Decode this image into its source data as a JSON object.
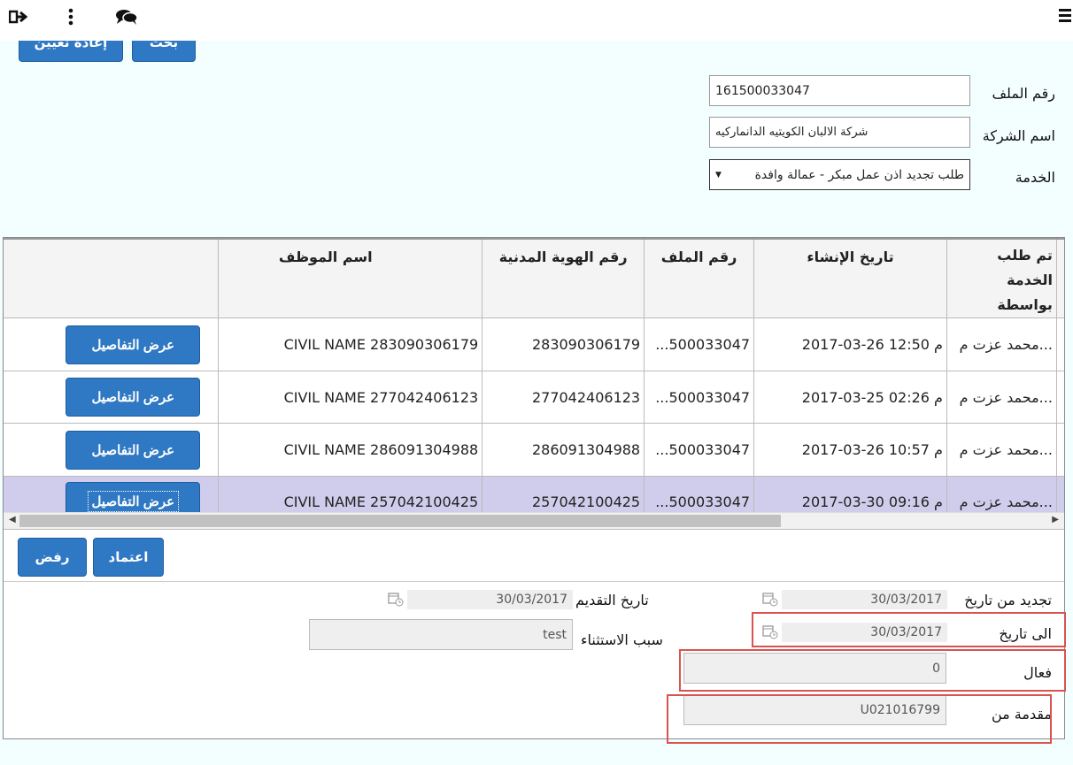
{
  "top_actions": {
    "top_buttons": {
      "search": "بحث",
      "reset": "إعادة تعيين"
    }
  },
  "form": {
    "file_no_label": "رقم الملف",
    "file_no_value": "161500033047",
    "company_label": "اسم الشركة",
    "company_value": "شركة الالبان الكويتيه الدانماركيه",
    "service_label": "الخدمة",
    "service_value": "طلب تجديد اذن عمل مبكر - عمالة وافدة"
  },
  "table": {
    "headers": [
      "تم طلب الخدمة بواسطة",
      "تاريخ الإنشاء",
      "رقم الملف",
      "رقم الهوية المدنية",
      "اسم الموظف",
      ""
    ],
    "detail_label": "عرض التفاصيل",
    "rows": [
      {
        "requested_by": "محمد عزت م...",
        "created": "2017-03-26 م 12:50",
        "file": "...500033047",
        "civil_id": "283090306179",
        "name": "CIVIL NAME 283090306179"
      },
      {
        "requested_by": "محمد عزت م...",
        "created": "2017-03-25 م 02:26",
        "file": "...500033047",
        "civil_id": "277042406123",
        "name": "CIVIL NAME 277042406123"
      },
      {
        "requested_by": "محمد عزت م...",
        "created": "2017-03-26 م 10:57",
        "file": "...500033047",
        "civil_id": "286091304988",
        "name": "CIVIL NAME 286091304988"
      },
      {
        "requested_by": "محمد عزت م...",
        "created": "2017-03-30 م 09:16",
        "file": "...500033047",
        "civil_id": "257042100425",
        "name": "CIVIL NAME 257042100425"
      }
    ]
  },
  "actions": {
    "approve": "اعتماد",
    "reject": "رفض"
  },
  "details": {
    "renew_from_label": "تجديد من تاريخ",
    "renew_from_value": "30/03/2017",
    "submit_date_label": "تاريخ التقديم",
    "submit_date_value": "30/03/2017",
    "to_date_label": "الى تاريخ",
    "to_date_value": "30/03/2017",
    "exception_label": "سبب الاستثناء",
    "exception_value": "test",
    "active_label": "فعال",
    "active_value": "0",
    "submitted_by_label": "مقدمة من",
    "submitted_by_value": "U021016799"
  },
  "colors": {
    "primary_button": "#2f78c3",
    "selected_row": "#cfcdeb",
    "highlight_box": "#d9534f",
    "page_bg": "#f3feff"
  },
  "icons": [
    "logout-icon",
    "more-vertical-icon",
    "chat-icon",
    "menu-icon",
    "calendar-icon"
  ]
}
